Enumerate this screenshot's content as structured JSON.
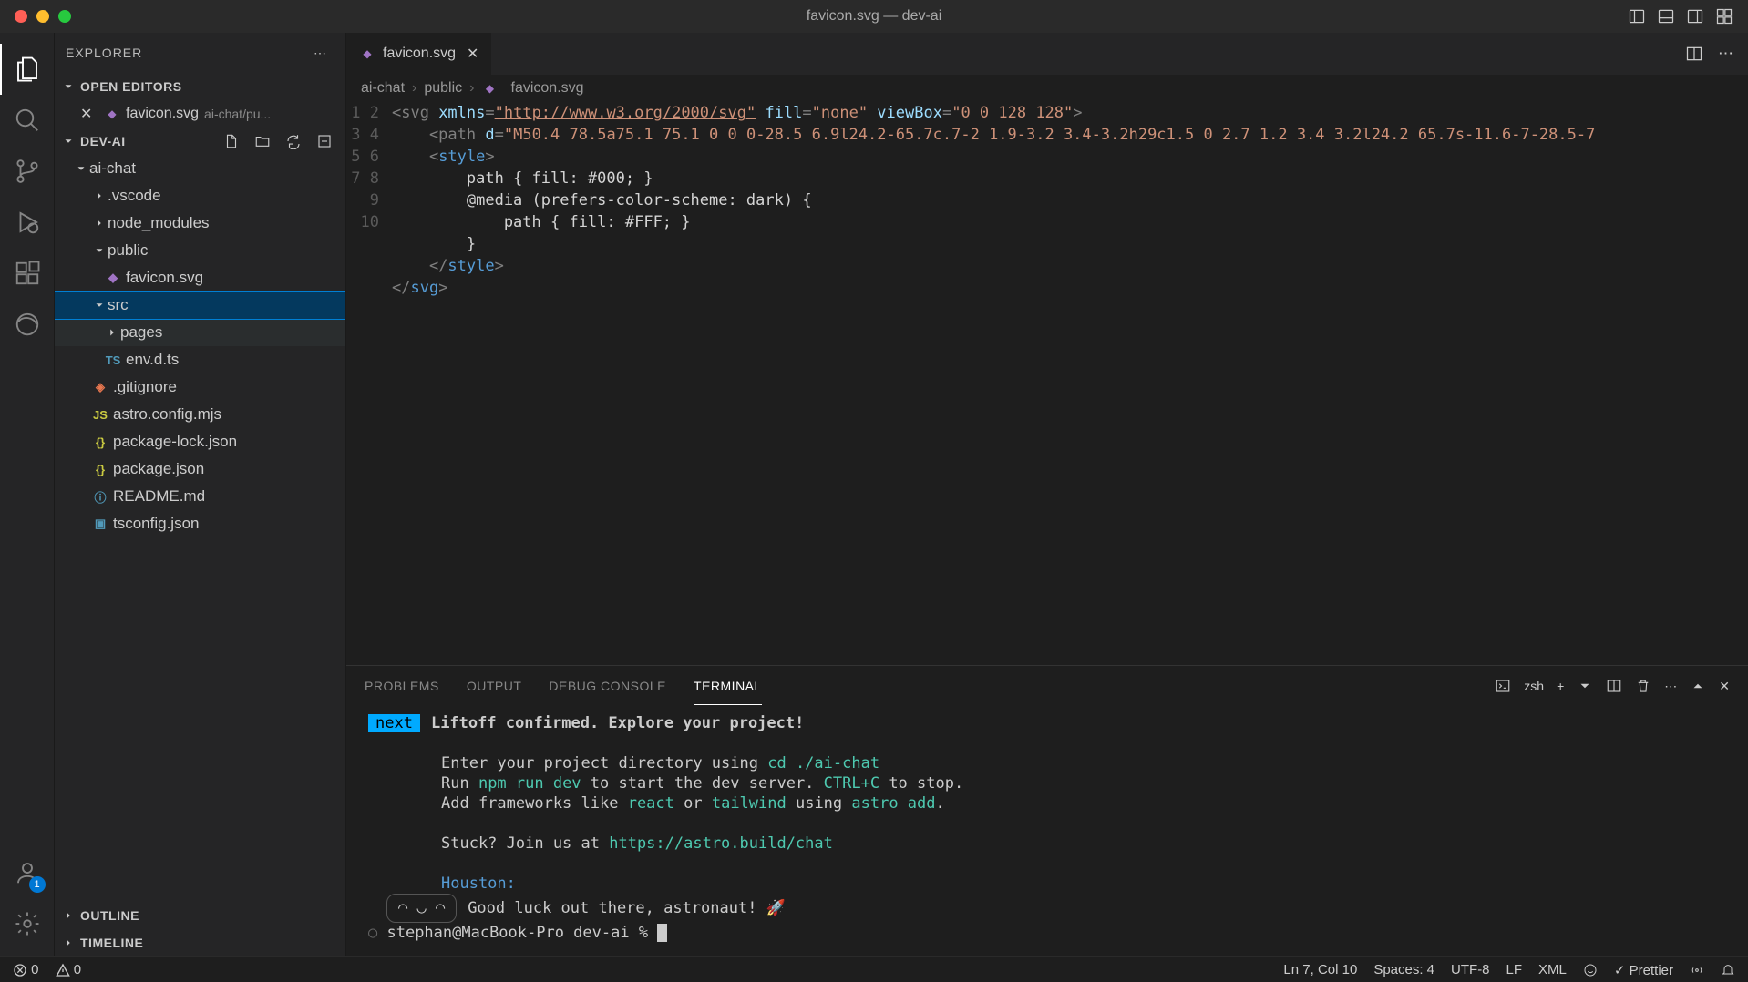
{
  "window": {
    "title": "favicon.svg — dev-ai"
  },
  "sidebar": {
    "title": "EXPLORER",
    "sections": {
      "open_editors": "OPEN EDITORS",
      "project": "DEV-AI",
      "outline": "OUTLINE",
      "timeline": "TIMELINE"
    },
    "open_editor": {
      "name": "favicon.svg",
      "path": "ai-chat/pu..."
    }
  },
  "tree": {
    "ai_chat": "ai-chat",
    "vscode": ".vscode",
    "node_modules": "node_modules",
    "public": "public",
    "favicon": "favicon.svg",
    "src": "src",
    "pages": "pages",
    "env": "env.d.ts",
    "gitignore": ".gitignore",
    "astro_config": "astro.config.mjs",
    "package_lock": "package-lock.json",
    "package": "package.json",
    "readme": "README.md",
    "tsconfig": "tsconfig.json"
  },
  "tab": {
    "name": "favicon.svg"
  },
  "breadcrumbs": {
    "a": "ai-chat",
    "b": "public",
    "c": "favicon.svg"
  },
  "code": {
    "l1a": "<svg",
    "l1b": " xmlns",
    "l1c": "=",
    "l1d": "\"http://www.w3.org/2000/svg\"",
    "l1e": " fill",
    "l1f": "=",
    "l1g": "\"none\"",
    "l1h": " viewBox",
    "l1i": "=",
    "l1j": "\"0 0 128 128\"",
    "l1k": ">",
    "l2a": "    <path",
    "l2b": " d",
    "l2c": "=",
    "l2d": "\"M50.4 78.5a75.1 75.1 0 0 0-28.5 6.9l24.2-65.7c.7-2 1.9-3.2 3.4-3.2h29c1.5 0 2.7 1.2 3.4 3.2l24.2 65.7s-11.6-7-28.5-7",
    "l3a": "    <style>",
    "l4": "        path { fill: #000; }",
    "l5": "        @media (prefers-color-scheme: dark) {",
    "l6": "            path { fill: #FFF; }",
    "l7": "        }",
    "l8a": "    </style>",
    "l9a": "</svg>"
  },
  "panel": {
    "tabs": {
      "problems": "PROBLEMS",
      "output": "OUTPUT",
      "debug": "DEBUG CONSOLE",
      "terminal": "TERMINAL"
    },
    "shell": "zsh"
  },
  "terminal": {
    "badge": "next",
    "headline": "Liftoff confirmed. Explore your project!",
    "line2a": "Enter your project directory using ",
    "line2b": "cd ./ai-chat",
    "line3a": "Run ",
    "line3b": "npm run dev",
    "line3c": " to start the dev server. ",
    "line3d": "CTRL+C",
    "line3e": " to stop.",
    "line4a": "Add frameworks like ",
    "line4b": "react",
    "line4c": " or ",
    "line4d": "tailwind",
    "line4e": " using ",
    "line4f": "astro add",
    "line4g": ".",
    "line5a": "Stuck? Join us at ",
    "line5b": "https://astro.build/chat",
    "houston": "Houston:",
    "goodluck": "Good luck out there, astronaut! 🚀",
    "ascii": "╭─────╮",
    "face": "◡ ◡ ╭",
    "prompt": "stephan@MacBook-Pro dev-ai % "
  },
  "status": {
    "errors": "0",
    "warnings": "0",
    "position": "Ln 7, Col 10",
    "spaces": "Spaces: 4",
    "encoding": "UTF-8",
    "eol": "LF",
    "lang": "XML",
    "prettier": "Prettier"
  }
}
